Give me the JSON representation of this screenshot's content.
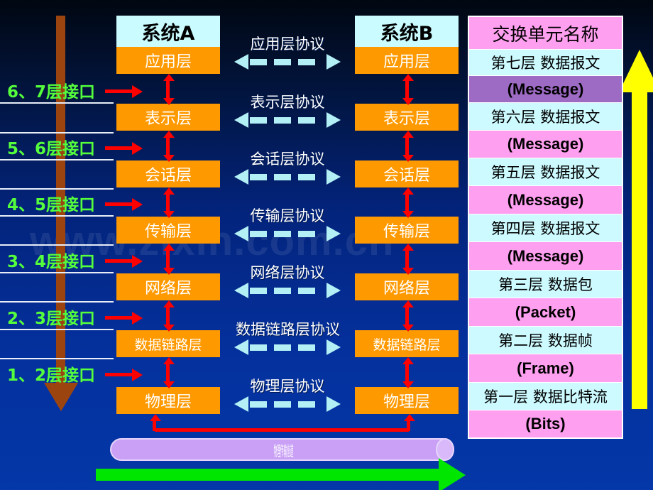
{
  "background": {
    "top_color": "#010711",
    "bottom_color": "#0437a8"
  },
  "watermark": {
    "text": "www.zixin.com.cn"
  },
  "systems": {
    "left": {
      "title": "系统A"
    },
    "right": {
      "title": "系统B"
    }
  },
  "layers": [
    {
      "name": "应用层",
      "short": "应用层"
    },
    {
      "name": "表示层",
      "short": "表示层"
    },
    {
      "name": "会话层",
      "short": "会话层"
    },
    {
      "name": "传输层",
      "short": "传输层"
    },
    {
      "name": "网络层",
      "short": "网络层"
    },
    {
      "name": "数据链路层",
      "short": "数据链路层"
    },
    {
      "name": "物理层",
      "short": "物理层"
    }
  ],
  "protocols": [
    {
      "label": "应用层协议"
    },
    {
      "label": "表示层协议"
    },
    {
      "label": "会话层协议"
    },
    {
      "label": "传输层协议"
    },
    {
      "label": "网络层协议"
    },
    {
      "label": "数据链路层协议"
    },
    {
      "label": "物理层协议"
    }
  ],
  "interfaces": [
    {
      "label": "6、7层接口"
    },
    {
      "label": "5、6层接口"
    },
    {
      "label": "4、5层接口"
    },
    {
      "label": "3、4层接口"
    },
    {
      "label": "2、3层接口"
    },
    {
      "label": "1、2层接口"
    }
  ],
  "pdu_table": {
    "title": "交换单元名称",
    "rows": [
      {
        "cn": "第七层 数据报文",
        "en": "(Message)",
        "en_style": "dark"
      },
      {
        "cn": "第六层 数据报文",
        "en": "(Message)",
        "en_style": "pink"
      },
      {
        "cn": "第五层 数据报文",
        "en": "(Message)",
        "en_style": "pink"
      },
      {
        "cn": "第四层 数据报文",
        "en": "(Message)",
        "en_style": "pink"
      },
      {
        "cn": "第三层 数据包",
        "en": "(Packet)",
        "en_style": "pink"
      },
      {
        "cn": "第二层 数据帧",
        "en": "(Frame)",
        "en_style": "pink"
      },
      {
        "cn": "第一层 数据比特流",
        "en": "(Bits)",
        "en_style": "pink"
      }
    ]
  },
  "channel": {
    "label": "物理传输信道"
  },
  "colors": {
    "layer_box": "#ff9900",
    "system_header": "#c9fbff",
    "pdu_cn": "#ccfaff",
    "pdu_en": "#ff9ff0",
    "pdu_en_dark": "#9d6bc4",
    "interface_text": "#55ff3c",
    "protocol_arrow": "#b2f0f5",
    "red_arrow": "#ff0000",
    "brown_arrow": "#9c4410",
    "yellow_arrow": "#ffff00",
    "green_arrow": "#00e600",
    "channel": "#c9a0f5"
  }
}
